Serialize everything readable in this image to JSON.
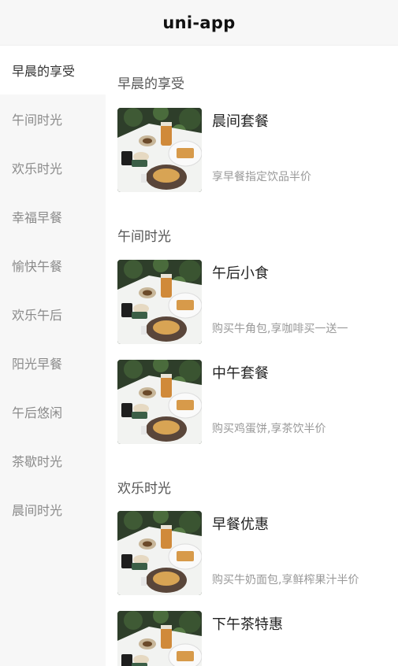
{
  "app": {
    "title": "uni-app"
  },
  "sidebar": {
    "items": [
      {
        "label": "早晨的享受"
      },
      {
        "label": "午间时光"
      },
      {
        "label": "欢乐时光"
      },
      {
        "label": "幸福早餐"
      },
      {
        "label": "愉快午餐"
      },
      {
        "label": "欢乐午后"
      },
      {
        "label": "阳光早餐"
      },
      {
        "label": "午后悠闲"
      },
      {
        "label": "茶歇时光"
      },
      {
        "label": "晨间时光"
      }
    ]
  },
  "sections": [
    {
      "title": "早晨的享受",
      "products": [
        {
          "name": "晨间套餐",
          "desc": "享早餐指定饮品半价",
          "image_icon": "breakfast-photo"
        }
      ]
    },
    {
      "title": "午间时光",
      "products": [
        {
          "name": "午后小食",
          "desc": "购买牛角包,享咖啡买一送一",
          "image_icon": "breakfast-photo"
        },
        {
          "name": "中午套餐",
          "desc": "购买鸡蛋饼,享茶饮半价",
          "image_icon": "breakfast-photo"
        }
      ]
    },
    {
      "title": "欢乐时光",
      "products": [
        {
          "name": "早餐优惠",
          "desc": "购买牛奶面包,享鲜榨果汁半价",
          "image_icon": "breakfast-photo"
        },
        {
          "name": "下午茶特惠",
          "desc": "",
          "image_icon": "breakfast-photo"
        }
      ]
    }
  ],
  "colors": {
    "sidebar_bg": "#f7f7f7",
    "active_item_bg": "#ffffff",
    "inactive_text": "#8a8a8a",
    "muted_text": "#999999"
  }
}
